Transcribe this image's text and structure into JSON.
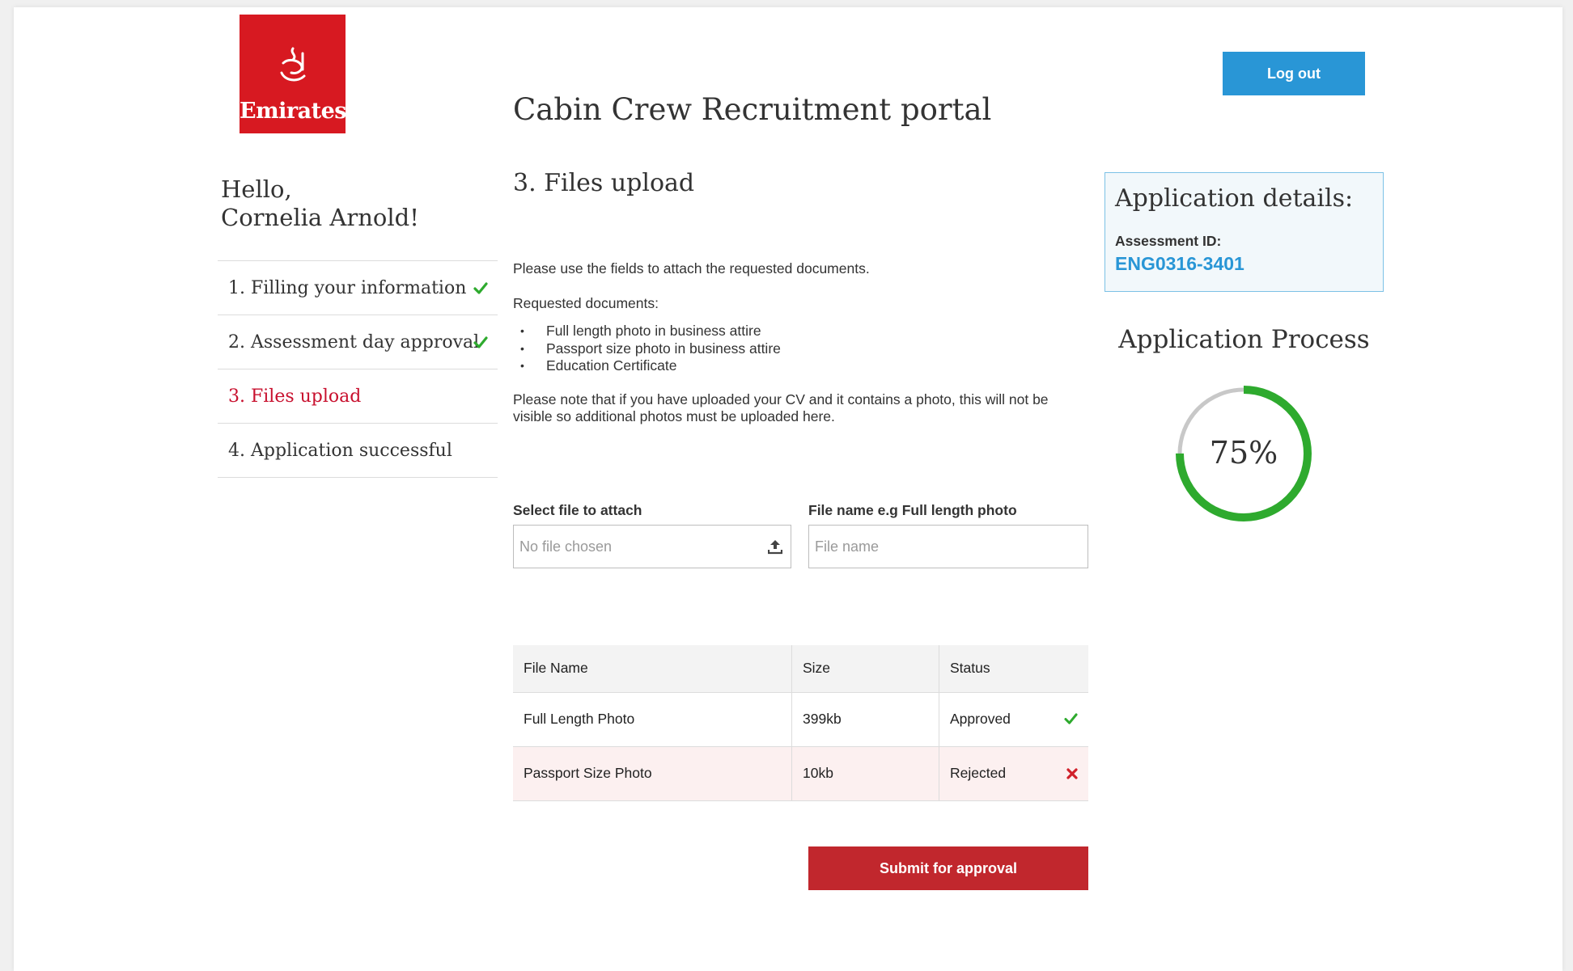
{
  "brand": {
    "name": "Emirates",
    "color": "#d71921"
  },
  "header": {
    "portal_title": "Cabin Crew Recruitment portal",
    "logout_label": "Log out"
  },
  "user": {
    "greeting": "Hello,",
    "name": "Cornelia Arnold!"
  },
  "steps": [
    {
      "label": "1. Filling your information",
      "status": "complete"
    },
    {
      "label": "2. Assessment day approval",
      "status": "complete"
    },
    {
      "label": "3. Files upload",
      "status": "active"
    },
    {
      "label": "4. Application successful",
      "status": "pending"
    }
  ],
  "main": {
    "section_title": "3. Files upload",
    "intro": "Please use the fields to attach the requested documents.",
    "requested_label": "Requested documents:",
    "requested_documents": [
      "Full length photo in business attire",
      "Passport size photo in business attire",
      "Education Certificate"
    ],
    "note": "Please note that if you have uploaded your CV and it contains a photo, this will not be visible so additional photos must be uploaded here.",
    "file_select": {
      "label": "Select file to attach",
      "placeholder": "No file chosen",
      "icon": "upload-icon"
    },
    "file_name": {
      "label": "File name e.g Full length photo",
      "placeholder": "File name"
    },
    "table": {
      "headers": [
        "File Name",
        "Size",
        "Status"
      ],
      "rows": [
        {
          "name": "Full Length Photo",
          "size": "399kb",
          "status": "Approved",
          "icon": "check-icon"
        },
        {
          "name": "Passport Size Photo",
          "size": "10kb",
          "status": "Rejected",
          "icon": "cross-icon"
        }
      ]
    },
    "submit_label": "Submit for approval"
  },
  "sidebar_right": {
    "details_title": "Application details:",
    "assessment_label": "Assessment ID:",
    "assessment_id": "ENG0316-3401",
    "process_title": "Application Process",
    "progress_label": "75%",
    "progress_value": 0.75
  },
  "colors": {
    "accent_blue": "#2996d6",
    "active_red": "#c8102e",
    "submit_red": "#c1272d",
    "success_green": "#2eaa2e",
    "reject_red": "#d0202a",
    "gauge_track": "#c8c8c8"
  }
}
